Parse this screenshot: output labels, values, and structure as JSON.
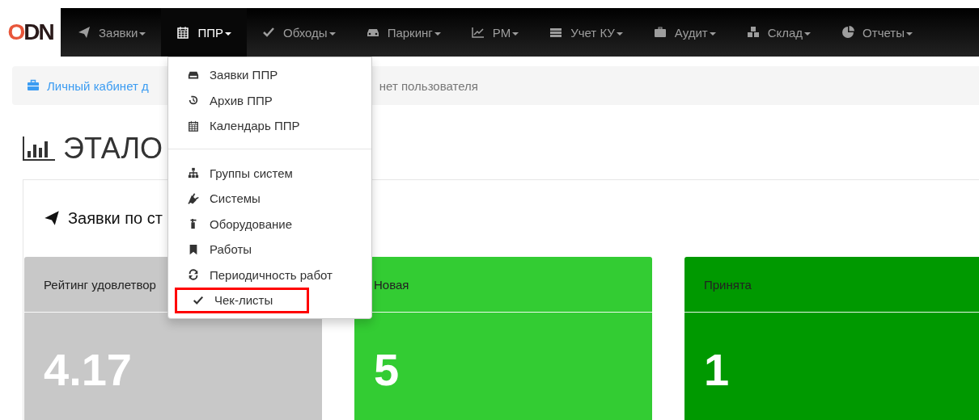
{
  "logo": "ODN",
  "navbar": {
    "items": [
      {
        "label": "Заявки",
        "selected": false
      },
      {
        "label": "ППР",
        "selected": true
      },
      {
        "label": "Обходы",
        "selected": false
      },
      {
        "label": "Паркинг",
        "selected": false
      },
      {
        "label": "РМ",
        "selected": false
      },
      {
        "label": "Учет КУ",
        "selected": false
      },
      {
        "label": "Аудит",
        "selected": false
      },
      {
        "label": "Склад",
        "selected": false
      },
      {
        "label": "Отчеты",
        "selected": false
      }
    ]
  },
  "dropdown": {
    "groups": [
      [
        {
          "label": "Заявки ППР",
          "highlighted": false
        },
        {
          "label": "Архив ППР",
          "highlighted": false
        },
        {
          "label": "Календарь ППР",
          "highlighted": false
        }
      ],
      [
        {
          "label": "Группы систем",
          "highlighted": false
        },
        {
          "label": "Системы",
          "highlighted": false
        },
        {
          "label": "Оборудование",
          "highlighted": false
        },
        {
          "label": "Работы",
          "highlighted": false
        },
        {
          "label": "Периодичность работ",
          "highlighted": false
        },
        {
          "label": "Чек-листы",
          "highlighted": true
        }
      ]
    ]
  },
  "breadcrumb": {
    "link": "Личный кабинет д",
    "current": "нет пользователя"
  },
  "heading": "ЭТАЛО",
  "panel": {
    "title": "Заявки по ст",
    "tiles": [
      {
        "title": "Рейтинг удовлетвор",
        "value": "4.17",
        "color": "#c8c8c8"
      },
      {
        "title": "Новая",
        "value": "5",
        "color": "#33cc33"
      },
      {
        "title": "Принята",
        "value": "1",
        "color": "#009900"
      }
    ]
  }
}
